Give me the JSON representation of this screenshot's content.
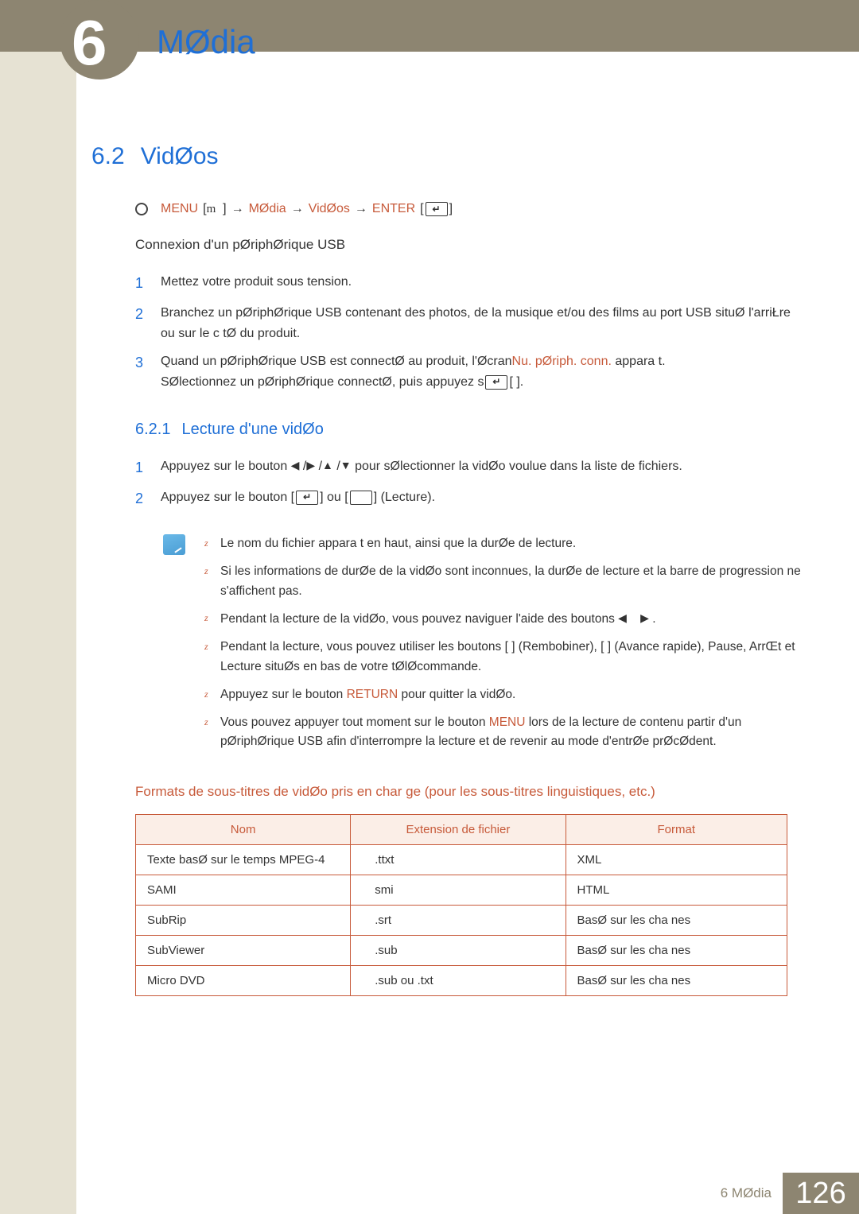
{
  "header": {
    "chapter_number": "6",
    "title": "MØdia"
  },
  "section": {
    "number": "6.2",
    "title": "VidØos"
  },
  "nav_path": {
    "menu": "MENU",
    "p1": "MØdia",
    "p2": "VidØos",
    "enter": "ENTER"
  },
  "usb": {
    "heading": "Connexion d'un pØriphØrique USB",
    "steps": [
      "Mettez votre produit sous tension.",
      "Branchez un pØriphØrique USB contenant des photos, de la musique et/ou des films au port USB situØ   l'arriŁre ou sur le c tØ du produit.",
      "Quand un pØriphØrique USB est connectØ au produit, l'Øcran"
    ],
    "step3_orange": "Nu. pØriph. conn.",
    "step3_after": " appara t.",
    "step3_line2a": "SØlectionnez un pØriphØrique connectØ, puis appuyez s",
    "step3_line2b": "[       ]."
  },
  "subsection": {
    "number": "6.2.1",
    "title": "Lecture d'une vidØo"
  },
  "play_steps": {
    "s1a": "Appuyez sur le bouton ",
    "s1b": " pour sØlectionner la vidØo voulue dans la liste de fichiers.",
    "s2a": "Appuyez sur le bouton [",
    "s2b": "] ou [",
    "s2c": "] (Lecture)."
  },
  "notes": [
    "Le nom du fichier appara t en haut, ainsi que la durØe de lecture.",
    "Si les informations de durØe de la vidØo sont inconnues, la durØe de lecture et la barre de progression ne s'affichent pas.",
    "Pendant la lecture de la vidØo, vous pouvez naviguer   l'aide des boutons",
    "Pendant la lecture, vous pouvez utiliser les boutons [       ] (Rembobiner), [       ] (Avance rapide), Pause, ArrŒt et Lecture situØs en bas de votre tØlØcommande.",
    "Appuyez sur le bouton",
    "Vous pouvez appuyer   tout moment sur le bouton"
  ],
  "note3_tail": "     .",
  "note5_return": "RETURN",
  "note5_tail": " pour quitter la vidØo.",
  "note6_menu": "MENU",
  "note6_tail": " lors de la lecture de contenu   partir d'un pØriphØrique USB afin d'interrompre la lecture et de revenir au mode d'entrØe prØcØdent.",
  "table": {
    "heading": "Formats de sous-titres de vidØo pris en char   ge (pour les sous-titres linguistiques, etc.)",
    "headers": [
      "Nom",
      "Extension de fichier",
      "Format"
    ],
    "rows": [
      [
        "Texte basØ sur le temps MPEG-4",
        ".ttxt",
        "XML"
      ],
      [
        "SAMI",
        "smi",
        "HTML"
      ],
      [
        "SubRip",
        ".srt",
        "BasØ sur les cha nes"
      ],
      [
        "SubViewer",
        ".sub",
        "BasØ sur les cha nes"
      ],
      [
        "Micro DVD",
        ".sub ou .txt",
        "BasØ sur les cha nes"
      ]
    ]
  },
  "footer": {
    "chapter_label": "6 MØdia",
    "page": "126"
  }
}
